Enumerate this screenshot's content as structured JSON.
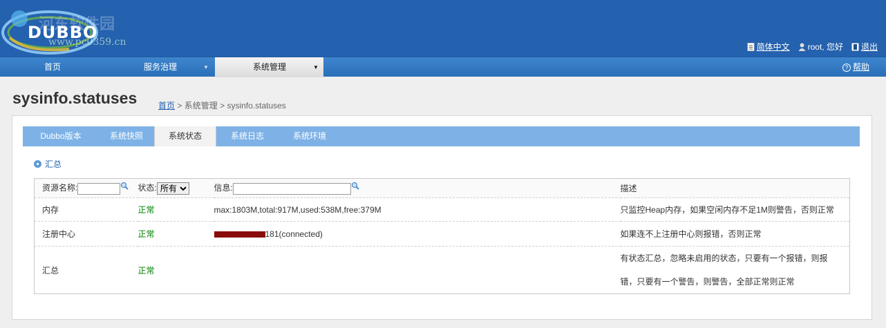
{
  "header": {
    "logo_text": "DUBBO",
    "watermark": "河东软件园",
    "watermark_url": "www.pc0359.cn",
    "lang_link": "简体中文",
    "greeting": "root, 您好",
    "logout": "退出"
  },
  "nav": {
    "items": [
      {
        "label": "首页"
      },
      {
        "label": "服务治理"
      },
      {
        "label": "系统管理"
      }
    ],
    "help": "帮助"
  },
  "page": {
    "title": "sysinfo.statuses",
    "breadcrumb": {
      "home": "首页",
      "sep": ">",
      "section": "系统管理",
      "current": "sysinfo.statuses"
    }
  },
  "tabs": [
    {
      "label": "Dubbo版本"
    },
    {
      "label": "系统快照"
    },
    {
      "label": "系统状态"
    },
    {
      "label": "系统日志"
    },
    {
      "label": "系统环境"
    }
  ],
  "summary_title": "汇总",
  "filters": {
    "resource_label": "资源名称:",
    "status_label": "状态:",
    "status_value": "所有",
    "info_label": "信息:",
    "desc_header": "描述"
  },
  "rows": [
    {
      "name": "内存",
      "status": "正常",
      "info": "max:1803M,total:917M,used:538M,free:379M",
      "desc": "只监控Heap内存，如果空闲内存不足1M则警告，否则正常"
    },
    {
      "name": "注册中心",
      "status": "正常",
      "info_suffix": "181(connected)",
      "desc": "如果连不上注册中心则报错，否则正常"
    },
    {
      "name": "汇总",
      "status": "正常",
      "info": "",
      "desc_line1": "有状态汇总，忽略未启用的状态，只要有一个报错，则报",
      "desc_line2": "错，只要有一个警告，则警告，全部正常则正常"
    }
  ],
  "colors": {
    "header_bg": "#2461ae",
    "nav_bg": "#3e86cf",
    "tab_bg": "#7eb2e6",
    "ok": "#008000",
    "redaction": "#8a0c0c"
  }
}
